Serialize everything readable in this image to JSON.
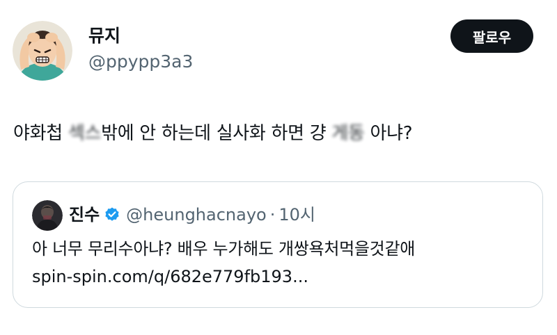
{
  "tweet": {
    "author": {
      "display_name": "뮤지",
      "handle": "@ppypp3a3",
      "avatar": "cartoon-stressed-man-avatar"
    },
    "follow_button_label": "팔로우",
    "text": {
      "part1": "야화첩 ",
      "blurred1": "섹스",
      "part2": "밖에 안 하는데 실사화 하면 걍 ",
      "blurred2": "게동",
      "part3": " 아냐?"
    },
    "quote": {
      "author_name": "진수",
      "verified": true,
      "handle": "@heunghacnayo",
      "separator": "·",
      "time": "10시",
      "text": "아 너무 무리수아냐? 배우 누가해도 개쌍욕처먹을것같애",
      "link": "spin-spin.com/q/682e779fb193..."
    }
  },
  "colors": {
    "text_primary": "#0f1419",
    "text_secondary": "#536471",
    "verified_blue": "#1d9bf0",
    "border": "#cfd9de",
    "follow_bg": "#0f1419"
  }
}
